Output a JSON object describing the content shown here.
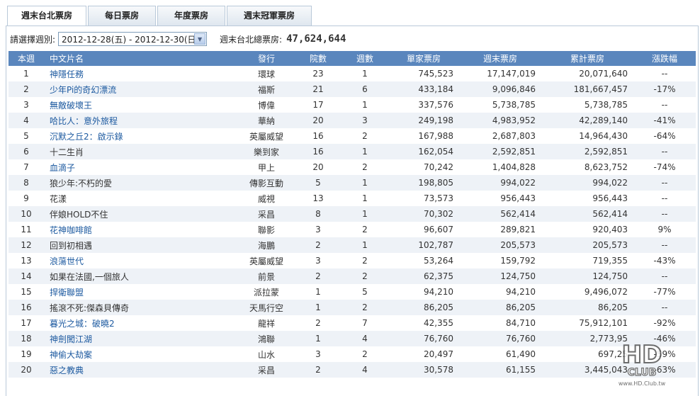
{
  "tabs": [
    {
      "label": "週末台北票房",
      "active": true
    },
    {
      "label": "每日票房",
      "active": false
    },
    {
      "label": "年度票房",
      "active": false
    },
    {
      "label": "週末冠軍票房",
      "active": false
    }
  ],
  "filter": {
    "label": "請選擇週別:",
    "selected_week": "2012-12-28(五) - 2012-12-30(日)",
    "total_label": "週末台北總票房:",
    "total_value": "47,624,644"
  },
  "table": {
    "headers": [
      "本週",
      "中文片名",
      "發行",
      "院數",
      "週數",
      "單家票房",
      "週末票房",
      "累計票房",
      "漲跌幅"
    ],
    "rows": [
      {
        "rank": "1",
        "title": "神隱任務",
        "link": true,
        "distributor": "環球",
        "theaters": "23",
        "weeks": "1",
        "per_theater": "745,523",
        "weekend": "17,147,019",
        "cumulative": "20,071,640",
        "change": "--"
      },
      {
        "rank": "2",
        "title": "少年Pi的奇幻漂流",
        "link": true,
        "distributor": "福斯",
        "theaters": "21",
        "weeks": "6",
        "per_theater": "433,184",
        "weekend": "9,096,846",
        "cumulative": "181,667,457",
        "change": "-17%"
      },
      {
        "rank": "3",
        "title": "無敵破壞王",
        "link": true,
        "distributor": "博偉",
        "theaters": "17",
        "weeks": "1",
        "per_theater": "337,576",
        "weekend": "5,738,785",
        "cumulative": "5,738,785",
        "change": "--"
      },
      {
        "rank": "4",
        "title": "哈比人：意外旅程",
        "link": true,
        "distributor": "華納",
        "theaters": "20",
        "weeks": "3",
        "per_theater": "249,198",
        "weekend": "4,983,952",
        "cumulative": "42,289,140",
        "change": "-41%"
      },
      {
        "rank": "5",
        "title": "沉默之丘2：啟示錄",
        "link": true,
        "distributor": "英屬威望",
        "theaters": "16",
        "weeks": "2",
        "per_theater": "167,988",
        "weekend": "2,687,803",
        "cumulative": "14,964,430",
        "change": "-64%"
      },
      {
        "rank": "6",
        "title": "十二生肖",
        "link": false,
        "distributor": "樂到家",
        "theaters": "16",
        "weeks": "1",
        "per_theater": "162,054",
        "weekend": "2,592,851",
        "cumulative": "2,592,851",
        "change": "--"
      },
      {
        "rank": "7",
        "title": "血滴子",
        "link": true,
        "distributor": "甲上",
        "theaters": "20",
        "weeks": "2",
        "per_theater": "70,242",
        "weekend": "1,404,828",
        "cumulative": "8,623,752",
        "change": "-74%"
      },
      {
        "rank": "8",
        "title": "狼少年:不朽的愛",
        "link": false,
        "distributor": "傳影互動",
        "theaters": "5",
        "weeks": "1",
        "per_theater": "198,805",
        "weekend": "994,022",
        "cumulative": "994,022",
        "change": "--"
      },
      {
        "rank": "9",
        "title": "花漾",
        "link": false,
        "distributor": "威視",
        "theaters": "13",
        "weeks": "1",
        "per_theater": "73,573",
        "weekend": "956,443",
        "cumulative": "956,443",
        "change": "--"
      },
      {
        "rank": "10",
        "title": "伴娘HOLD不住",
        "link": false,
        "distributor": "采昌",
        "theaters": "8",
        "weeks": "1",
        "per_theater": "70,302",
        "weekend": "562,414",
        "cumulative": "562,414",
        "change": "--"
      },
      {
        "rank": "11",
        "title": "花神咖啡館",
        "link": true,
        "distributor": "聯影",
        "theaters": "3",
        "weeks": "2",
        "per_theater": "96,607",
        "weekend": "289,821",
        "cumulative": "920,403",
        "change": "9%"
      },
      {
        "rank": "12",
        "title": "回到初相遇",
        "link": false,
        "distributor": "海鵬",
        "theaters": "2",
        "weeks": "1",
        "per_theater": "102,787",
        "weekend": "205,573",
        "cumulative": "205,573",
        "change": "--"
      },
      {
        "rank": "13",
        "title": "浪蕩世代",
        "link": true,
        "distributor": "英屬威望",
        "theaters": "3",
        "weeks": "2",
        "per_theater": "53,264",
        "weekend": "159,792",
        "cumulative": "719,355",
        "change": "-43%"
      },
      {
        "rank": "14",
        "title": "如果在法國,一個旅人",
        "link": false,
        "distributor": "前景",
        "theaters": "2",
        "weeks": "2",
        "per_theater": "62,375",
        "weekend": "124,750",
        "cumulative": "124,750",
        "change": "--"
      },
      {
        "rank": "15",
        "title": "捍衛聯盟",
        "link": true,
        "distributor": "派拉蒙",
        "theaters": "1",
        "weeks": "5",
        "per_theater": "94,210",
        "weekend": "94,210",
        "cumulative": "9,496,072",
        "change": "-77%"
      },
      {
        "rank": "16",
        "title": "搖滾不死:傑森貝傳奇",
        "link": false,
        "distributor": "天馬行空",
        "theaters": "1",
        "weeks": "2",
        "per_theater": "86,205",
        "weekend": "86,205",
        "cumulative": "86,205",
        "change": "--"
      },
      {
        "rank": "17",
        "title": "暮光之城：破曉2",
        "link": true,
        "distributor": "龍祥",
        "theaters": "2",
        "weeks": "7",
        "per_theater": "42,355",
        "weekend": "84,710",
        "cumulative": "75,912,101",
        "change": "-92%"
      },
      {
        "rank": "18",
        "title": "神劍闖江湖",
        "link": true,
        "distributor": "鴻聯",
        "theaters": "1",
        "weeks": "4",
        "per_theater": "76,760",
        "weekend": "76,760",
        "cumulative": "2,773,95",
        "change": "-46%"
      },
      {
        "rank": "19",
        "title": "神偷大劫案",
        "link": true,
        "distributor": "山水",
        "theaters": "3",
        "weeks": "2",
        "per_theater": "20,497",
        "weekend": "61,490",
        "cumulative": "697,25",
        "change": "-59%"
      },
      {
        "rank": "20",
        "title": "惡之教典",
        "link": true,
        "distributor": "采昌",
        "theaters": "2",
        "weeks": "4",
        "per_theater": "30,578",
        "weekend": "61,155",
        "cumulative": "3,445,043",
        "change": "-63%"
      }
    ]
  },
  "watermark": {
    "text": "HD CLUB",
    "url_text": "www.HD.Club.tw"
  },
  "colors": {
    "header_bg": "#5a86bd",
    "link": "#1d5aa0",
    "stripe": "#eef2f7"
  }
}
